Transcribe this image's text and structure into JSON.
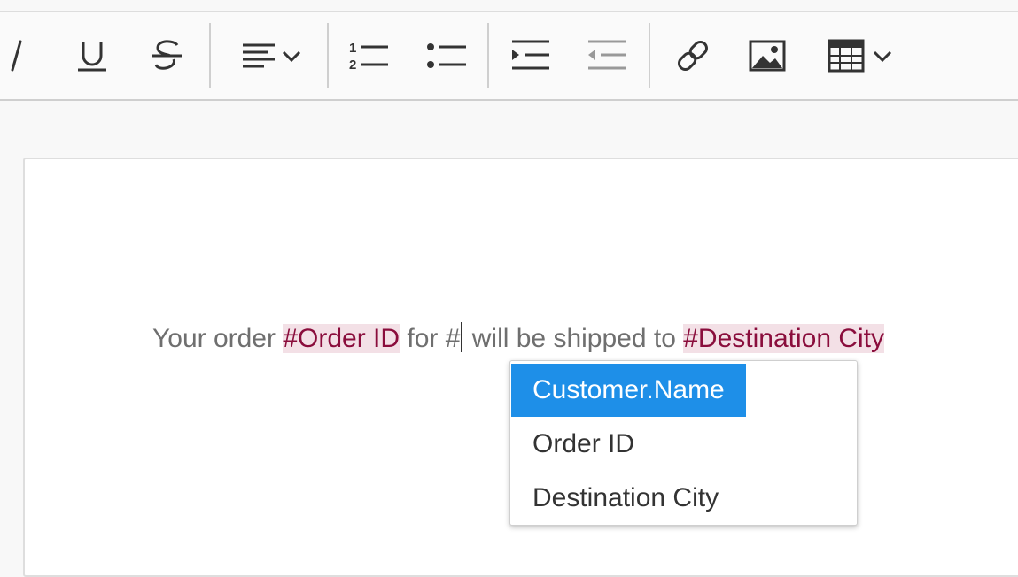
{
  "toolbar": {
    "buttons": [
      {
        "name": "italic-icon"
      },
      {
        "name": "underline-icon"
      },
      {
        "name": "strikethrough-icon"
      },
      {
        "name": "align-left-icon"
      },
      {
        "name": "numbered-list-icon"
      },
      {
        "name": "bulleted-list-icon"
      },
      {
        "name": "indent-icon"
      },
      {
        "name": "outdent-icon",
        "disabled": true
      },
      {
        "name": "link-icon"
      },
      {
        "name": "image-icon"
      },
      {
        "name": "table-icon"
      }
    ]
  },
  "editor": {
    "text_before": "Your order ",
    "tag_order": "#Order ID",
    "text_middle": " for #",
    "text_after": " will be shipped to ",
    "tag_city": "#Destination City"
  },
  "suggestions": {
    "items": [
      "Customer.Name",
      "Order ID",
      "Destination City"
    ],
    "selected_index": 0
  },
  "colors": {
    "accent": "#1e8fe8",
    "tag_text": "#8a0d3c",
    "tag_bg": "#f3e0e6"
  }
}
